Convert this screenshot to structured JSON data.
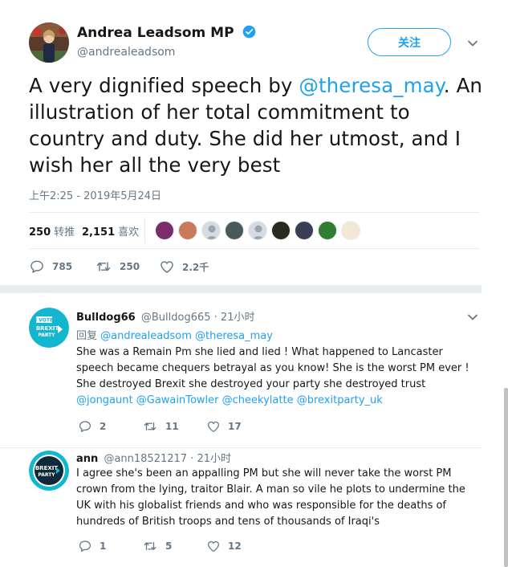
{
  "main_tweet": {
    "author_name": "Andrea Leadsom MP",
    "author_handle": "@andrealeadsom",
    "follow_label": "关注",
    "text_before": "A very dignified speech by ",
    "text_mention": "@theresa_may",
    "text_after": ". An illustration of her total commitment to country and duty.  She did her utmost, and I wish her all the very best",
    "timestamp": "上午2:25 - 2019年5月24日",
    "retweets_count": "250",
    "retweets_label": "转推",
    "likes_count": "2,151",
    "likes_label": "喜欢",
    "reply_count": "785",
    "retweet_count": "250",
    "like_count": "2.2千"
  },
  "replies": [
    {
      "name": "Bulldog66",
      "handle": "@Bulldog665",
      "time": "· 21小时",
      "reply_prefix": "回复",
      "reply_to_1": "@andrealeadsom",
      "reply_to_2": "@theresa_may",
      "avatar_line1": "I VOTE",
      "avatar_line2": "BREXIT",
      "avatar_line3": "PARTY",
      "text": "She was a Remain Pm she lied and lied ! What happened to Lancaster speech became chequers betrayal as you know! She is the worst PM ever ! She destroyed Brexit she destroyed your party she destroyed trust ",
      "mentions": [
        "@jongaunt",
        "@GawainTowler",
        "@cheekylatte",
        "@brexitparty_uk"
      ],
      "reply_count": "2",
      "retweet_count": "11",
      "like_count": "17"
    },
    {
      "name": "ann",
      "handle": "@ann18521217",
      "time": "· 21小时",
      "avatar_line1": "BREXIT",
      "avatar_line2": "PARTY",
      "text": "I agree she's been an appalling PM but she will never take the worst PM crown from the lying, traitor Blair. A man so vile he plots to undermine the UK with his globalist friends and who was responsible for the deaths of hundreds of British troops and tens of thousands of Iraqi's",
      "reply_count": "1",
      "retweet_count": "5",
      "like_count": "12"
    }
  ],
  "colors": {
    "accent": "#1da1f2",
    "secondary_text": "#657786",
    "primary_text": "#14171a",
    "border": "#e6ecf0",
    "brexit_teal": "#12b6cf"
  },
  "icons": [
    "verified-badge-icon",
    "chevron-down-icon",
    "reply-icon",
    "retweet-icon",
    "like-icon"
  ]
}
